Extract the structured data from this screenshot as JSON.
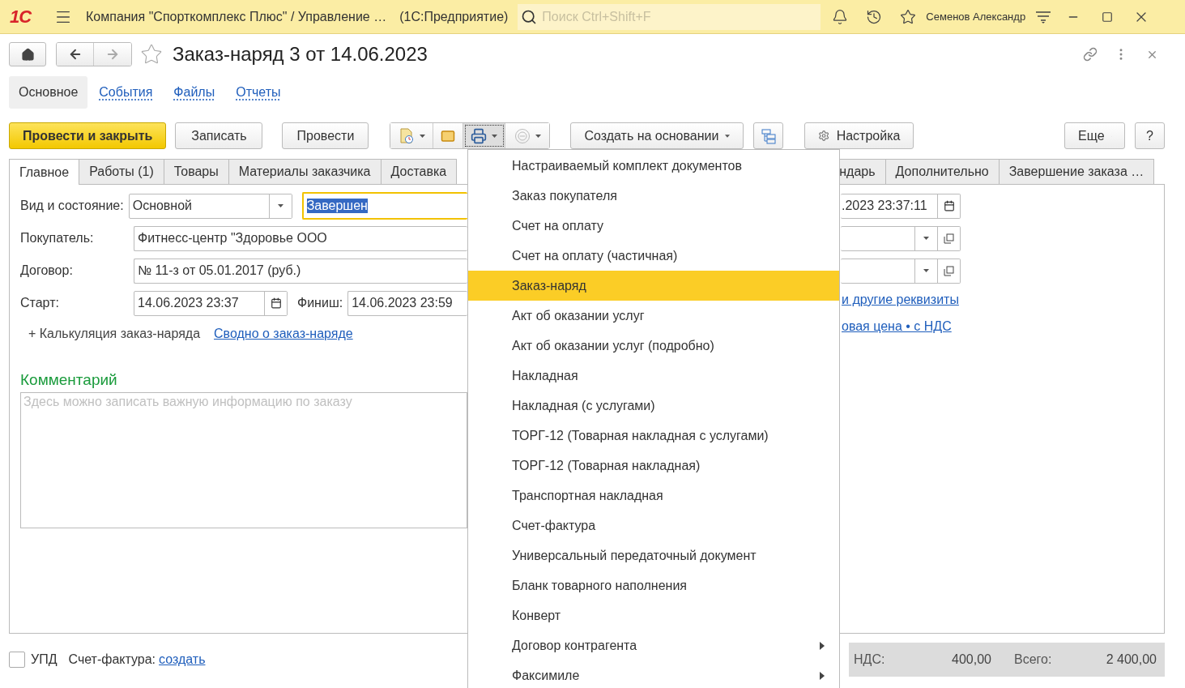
{
  "app": {
    "logo": "1С",
    "title": "Компания \"Спорткомплекс Плюс\" / Управление …",
    "product": "(1С:Предприятие)",
    "search": {
      "placeholder": "Поиск Ctrl+Shift+F"
    },
    "user": "Семенов Александр"
  },
  "document": {
    "title": "Заказ-наряд 3 от 14.06.2023",
    "starred": false
  },
  "sections": [
    {
      "label": "Основное",
      "selected": true
    },
    {
      "label": "События",
      "selected": false
    },
    {
      "label": "Файлы",
      "selected": false
    },
    {
      "label": "Отчеты",
      "selected": false
    }
  ],
  "commands": {
    "post_close": "Провести и закрыть",
    "save": "Записать",
    "post": "Провести",
    "print_pressed": true,
    "create_based": "Создать на основании",
    "settings": "Настройка",
    "more": "Еще",
    "help": "?"
  },
  "tabs_left": [
    {
      "label": "Главное",
      "selected": true
    },
    {
      "label": "Работы (1)",
      "selected": false
    },
    {
      "label": "Товары",
      "selected": false
    },
    {
      "label": "Материалы заказчика",
      "selected": false
    },
    {
      "label": "Доставка",
      "selected": false
    }
  ],
  "tabs_right": [
    {
      "label": "ндарь",
      "selected": false
    },
    {
      "label": "Дополнительно",
      "selected": false
    },
    {
      "label": "Завершение заказа …",
      "selected": false
    }
  ],
  "form": {
    "kind_label": "Вид и состояние:",
    "kind_value": "Основной",
    "status_value": "Завершен",
    "customer_label": "Покупатель:",
    "customer_value": "Фитнесс-центр \"Здоровье ООО",
    "contract_label": "Договор:",
    "contract_value": "№ 11-з от 05.01.2017 (руб.)",
    "start_label": "Старт:",
    "start_value": "14.06.2023 23:37",
    "finish_label": "Финиш:",
    "finish_value": "14.06.2023 23:59",
    "calc_toggle": "+ Калькуляция заказ-наряда",
    "summary_link": "Сводно о заказ-наряде",
    "comment_heading": "Комментарий",
    "comment_placeholder": "Здесь можно записать важную информацию по заказу"
  },
  "form_right": {
    "date_value": ".2023 23:37:11",
    "link_1": "и другие реквизиты",
    "link_2": "овая цена • с НДС"
  },
  "print_menu": [
    {
      "label": "Настраиваемый комплект документов",
      "selected": false,
      "kind": "item"
    },
    {
      "label": "Заказ покупателя",
      "selected": false,
      "kind": "item"
    },
    {
      "label": "Счет на оплату",
      "selected": false,
      "kind": "item"
    },
    {
      "label": "Счет на оплату (частичная)",
      "selected": false,
      "kind": "item"
    },
    {
      "label": "Заказ-наряд",
      "selected": true,
      "kind": "item"
    },
    {
      "label": "Акт об оказании услуг",
      "selected": false,
      "kind": "item"
    },
    {
      "label": "Акт об оказании услуг (подробно)",
      "selected": false,
      "kind": "item"
    },
    {
      "label": "Накладная",
      "selected": false,
      "kind": "item"
    },
    {
      "label": "Накладная (с услугами)",
      "selected": false,
      "kind": "item"
    },
    {
      "label": "ТОРГ-12 (Товарная накладная с услугами)",
      "selected": false,
      "kind": "item"
    },
    {
      "label": "ТОРГ-12 (Товарная накладная)",
      "selected": false,
      "kind": "item"
    },
    {
      "label": "Транспортная накладная",
      "selected": false,
      "kind": "item"
    },
    {
      "label": "Счет-фактура",
      "selected": false,
      "kind": "item"
    },
    {
      "label": "Универсальный передаточный документ",
      "selected": false,
      "kind": "item"
    },
    {
      "label": "Бланк товарного наполнения",
      "selected": false,
      "kind": "item"
    },
    {
      "label": "Конверт",
      "selected": false,
      "kind": "item"
    },
    {
      "label": "Договор контрагента",
      "selected": false,
      "kind": "submenu"
    },
    {
      "label": "Факсимиле",
      "selected": false,
      "kind": "submenu"
    }
  ],
  "footer": {
    "upd": {
      "label": "УПД",
      "checked": false
    },
    "invoice_label": "Счет-фактура:",
    "invoice_link": "создать"
  },
  "totals": [
    {
      "label": "НДС:",
      "value": "400,00"
    },
    {
      "label": "Всего:",
      "value": "2 400,00"
    }
  ]
}
